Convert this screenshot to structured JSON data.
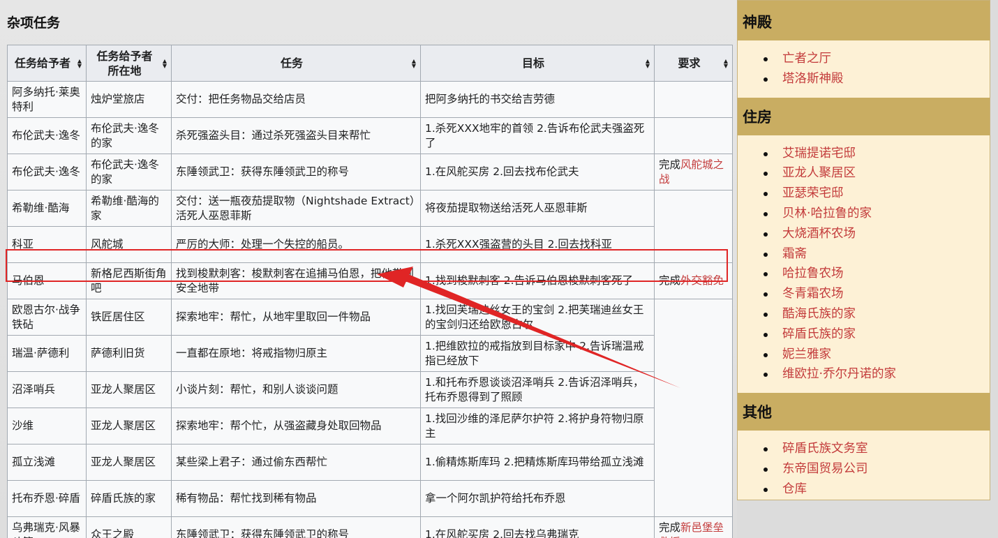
{
  "section_title": "杂项任务",
  "table": {
    "headers": [
      "任务给予者",
      "任务给予者所在地",
      "任务",
      "目标",
      "要求"
    ],
    "rows": [
      {
        "giver": "阿多纳托·莱奥特利",
        "location": "烛炉堂旅店",
        "quest": "交付：把任务物品交给店员",
        "goal": "把阿多纳托的书交给吉劳德",
        "req_prefix": "",
        "req_link": ""
      },
      {
        "giver": "布伦武夫·逸冬",
        "location": "布伦武夫·逸冬的家",
        "quest": "杀死强盗头目：通过杀死强盗头目来帮忙",
        "goal": "1.杀死XXX地牢的首领 2.告诉布伦武夫强盗死了",
        "req_prefix": "",
        "req_link": ""
      },
      {
        "giver": "布伦武夫·逸冬",
        "location": "布伦武夫·逸冬的家",
        "quest": "东陲领武卫：获得东陲领武卫的称号",
        "goal": "1.在风舵买房 2.回去找布伦武夫",
        "req_prefix": "完成",
        "req_link": "风舵城之战"
      },
      {
        "giver": "希勒维·酷海",
        "location": "希勒维·酷海的家",
        "quest": "交付：送一瓶夜茄提取物（Nightshade Extract）活死人巫恩菲斯",
        "goal": "将夜茄提取物送给活死人巫恩菲斯",
        "req_prefix": "",
        "req_link": ""
      },
      {
        "giver": "科亚",
        "location": "风舵城",
        "quest": "严厉的大师：处理一个失控的船员。",
        "goal": "1.杀死XXX强盗营的头目 2.回去找科亚",
        "req_prefix": "",
        "req_link": ""
      },
      {
        "giver": "马伯恩",
        "location": "新格尼西斯街角吧",
        "quest": "找到梭默刺客：梭默刺客在追捕马伯恩，把他带到安全地带",
        "goal": "1.找到梭默刺客 2.告诉马伯恩梭默刺客死了",
        "req_prefix": "完成",
        "req_link": "外交豁免"
      },
      {
        "giver": "欧恩古尔·战争铁砧",
        "location": "铁匠居住区",
        "quest": "探索地牢：帮忙，从地牢里取回一件物品",
        "goal": "1.找回芙瑞迪丝女王的宝剑 2.把芙瑞迪丝女王的宝剑归还给欧恩古尔",
        "req_prefix": "",
        "req_link": ""
      },
      {
        "giver": "瑞温·萨德利",
        "location": "萨德利旧货",
        "quest": "一直都在原地：将戒指物归原主",
        "goal": "1.把维欧拉的戒指放到目标家中 2.告诉瑞温戒指已经放下",
        "req_prefix": "",
        "req_link": ""
      },
      {
        "giver": "沼泽哨兵",
        "location": "亚龙人聚居区",
        "quest": "小谈片刻：帮忙，和别人谈谈问题",
        "goal": "1.和托布乔恩谈谈沼泽哨兵 2.告诉沼泽哨兵，托布乔恩得到了照顾",
        "req_prefix": "",
        "req_link": ""
      },
      {
        "giver": "沙维",
        "location": "亚龙人聚居区",
        "quest": "探索地牢：帮个忙，从强盗藏身处取回物品",
        "goal": "1.找回沙维的泽尼萨尔护符 2.将护身符物归原主",
        "req_prefix": "",
        "req_link": ""
      },
      {
        "giver": "孤立浅滩",
        "location": "亚龙人聚居区",
        "quest": "某些梁上君子：通过偷东西帮忙",
        "goal": "1.偷精炼斯库玛 2.把精炼斯库玛带给孤立浅滩",
        "req_prefix": "",
        "req_link": ""
      },
      {
        "giver": "托布乔恩·碎盾",
        "location": "碎盾氏族的家",
        "quest": "稀有物品：帮忙找到稀有物品",
        "goal": "拿一个阿尔凯护符给托布乔恩",
        "req_prefix": "",
        "req_link": ""
      },
      {
        "giver": "乌弗瑞克·风暴斗篷",
        "location": "众王之殿",
        "quest": "东陲领武卫：获得东陲领武卫的称号",
        "goal": "1.在风舵买房 2.回去找乌弗瑞克",
        "req_prefix": "完成",
        "req_link": "新邑堡垒救援"
      }
    ]
  },
  "sidebar": {
    "sections": [
      {
        "title": "神殿",
        "items": [
          "亡者之厅",
          "塔洛斯神殿"
        ]
      },
      {
        "title": "住房",
        "items": [
          "艾瑞提诺宅邸",
          "亚龙人聚居区",
          "亚瑟荣宅邸",
          "贝林·哈拉鲁的家",
          "大烧酒杯农场",
          "霜斋",
          "哈拉鲁农场",
          "冬青霜农场",
          "酷海氏族的家",
          "碎盾氏族的家",
          "妮兰雅家",
          "维欧拉·乔尔丹诺的家"
        ]
      },
      {
        "title": "其他",
        "items": [
          "碎盾氏族文务室",
          "东帝国贸易公司",
          "仓库"
        ]
      }
    ]
  },
  "annotation": {
    "color": "#e02525"
  }
}
